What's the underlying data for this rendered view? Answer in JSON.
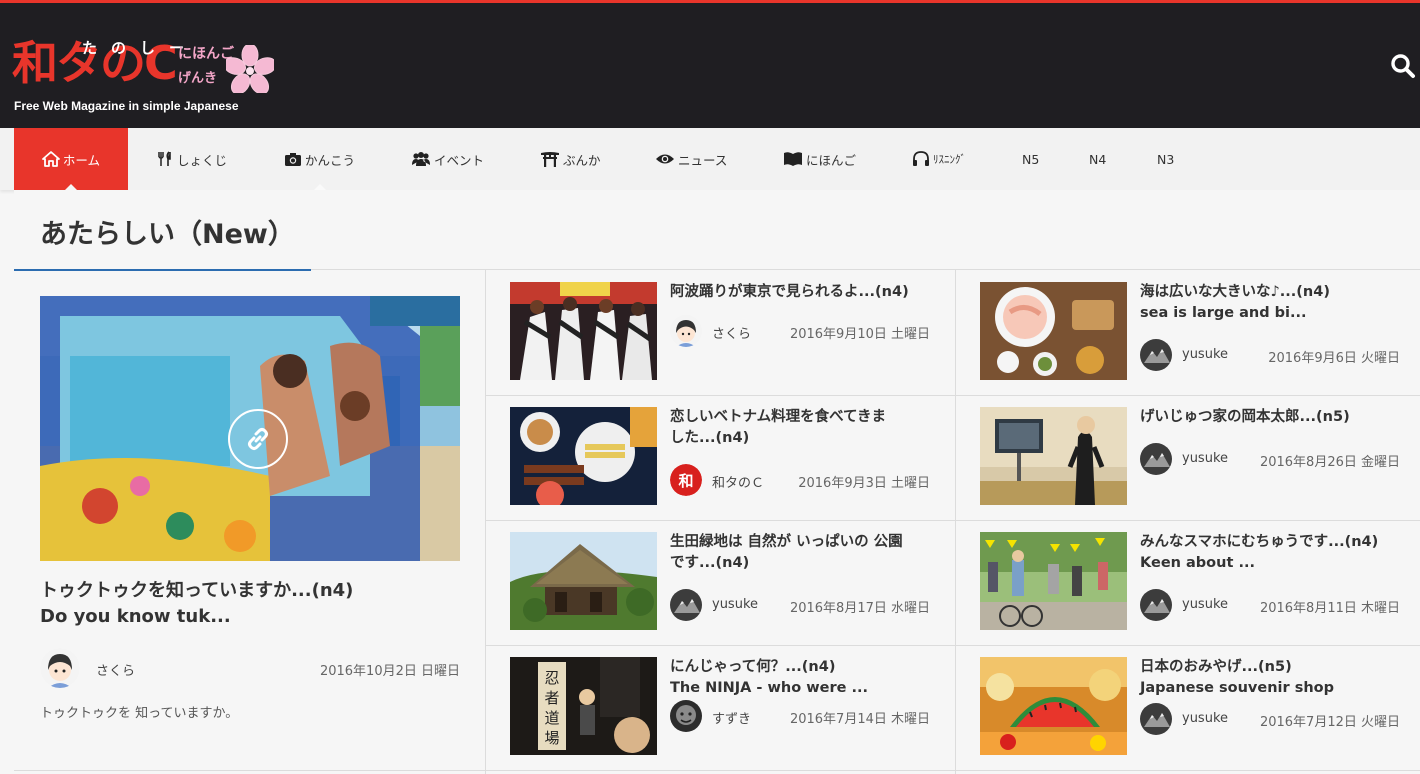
{
  "site": {
    "logo_main": "和タのC",
    "logo_ruby": "たのしー",
    "logo_tag_top": "にほんご",
    "logo_tag_bottom": "げんき",
    "tagline": "Free Web Magazine in simple Japanese",
    "accent_color": "#e8352b"
  },
  "nav": {
    "items": [
      {
        "label": "ホーム",
        "icon": "home-icon",
        "active": true
      },
      {
        "label": "しょくじ",
        "icon": "utensils-icon"
      },
      {
        "label": "かんこう",
        "icon": "camera-icon"
      },
      {
        "label": "イベント",
        "icon": "users-icon"
      },
      {
        "label": "ぶんか",
        "icon": "torii-icon"
      },
      {
        "label": "ニュース",
        "icon": "eye-icon"
      },
      {
        "label": "にほんご",
        "icon": "book-icon"
      },
      {
        "label": "ﾘｽﾆﾝｸﾞ",
        "icon": "headphones-icon"
      },
      {
        "label": "N5"
      },
      {
        "label": "N4"
      },
      {
        "label": "N3"
      }
    ]
  },
  "section": {
    "title": "あたらしい（New）"
  },
  "featured": {
    "title_line1": "トゥクトゥクを知っていますか...(n4)",
    "title_line2": "Do you know tuk...",
    "author": "さくら",
    "date": "2016年10月2日 日曜日",
    "excerpt": "トゥクトゥクを 知っていますか。"
  },
  "posts": [
    {
      "title_line1": "阿波踊りが東京で見られるよ...(n4)",
      "title_line2": "",
      "author": "さくら",
      "date": "2016年9月10日 土曜日"
    },
    {
      "title_line1": "海は広いな大きいな♪...(n4)",
      "title_line2": "sea is large and bi...",
      "author": "yusuke",
      "date": "2016年9月6日 火曜日"
    },
    {
      "title_line1": "恋しいベトナム料理を食べてきま",
      "title_line2": "した...(n4)",
      "author": "和タのＣ",
      "date": "2016年9月3日 土曜日"
    },
    {
      "title_line1": "げいじゅつ家の岡本太郎...(n5)",
      "title_line2": "",
      "author": "yusuke",
      "date": "2016年8月26日 金曜日"
    },
    {
      "title_line1": "生田緑地は 自然が いっぱいの 公園",
      "title_line2": "です...(n4)",
      "author": "yusuke",
      "date": "2016年8月17日 水曜日"
    },
    {
      "title_line1": "みんなスマホにむちゅうです...(n4)",
      "title_line2": "Keen about ...",
      "author": "yusuke",
      "date": "2016年8月11日 木曜日"
    },
    {
      "title_line1": "にんじゃって何？...(n4)",
      "title_line2": "The NINJA - who were ...",
      "author": "すずき",
      "date": "2016年7月14日 木曜日"
    },
    {
      "title_line1": "日本のおみやげ...(n5)",
      "title_line2": "Japanese souvenir shop",
      "author": "yusuke",
      "date": "2016年7月12日 火曜日"
    }
  ]
}
